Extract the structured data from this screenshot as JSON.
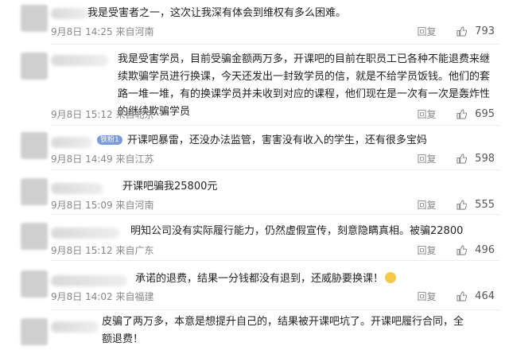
{
  "comments": [
    {
      "text": "我是受害者之一，这次让我深有体会到维权有多么困难。",
      "date": "9月8日 14:25",
      "location": "来自河南",
      "reply_label": "回复",
      "likes": "793"
    },
    {
      "text": "我是受害学员，目前受骗金额两万多，开课吧的目前在职员工已各种不能退费来继续欺骗学员进行换课，今天还发出一封致学员的信，就是不给学员饭钱。他们的套路一堆一堆，有的换课学员并未收到对应的课程，他们现在是一次有一次是轰炸性的继续欺骗学员",
      "date": "9月8日 15:12",
      "location": "来自北京",
      "reply_label": "回复",
      "likes": "695"
    },
    {
      "badge": "铁粉1",
      "text": "开课吧暴雷，还没办法监管，害害没有收入的学生，还有很多宝妈",
      "date": "9月8日 14:49",
      "location": "来自江苏",
      "reply_label": "回复",
      "likes": "598"
    },
    {
      "text": "开课吧骗我25800元",
      "date": "9月8日 15:09",
      "location": "来自河南",
      "reply_label": "回复",
      "likes": "555"
    },
    {
      "text": "明知公司没有实际履行能力，仍然虚假宣传，刻意隐瞒真相。被骗22800",
      "date": "9月8日 15:12",
      "location": "来自广东",
      "reply_label": "回复",
      "likes": "496"
    },
    {
      "text": "承诺的退费，结果一分钱都没有退到，还威胁要换课！",
      "emoji": "crying-face-emoji",
      "date": "9月8日 14:02",
      "location": "来自福建",
      "reply_label": "回复",
      "likes": "464"
    },
    {
      "text": "皮骗了两万多，本意是想提升自己的，结果被开课吧坑了。开课吧履行合同，全额退费！"
    }
  ],
  "icons": {
    "like": "thumbs-up-icon"
  },
  "colors": {
    "meta": "#888888",
    "text": "#222222",
    "badge": "#7b9bd9"
  }
}
